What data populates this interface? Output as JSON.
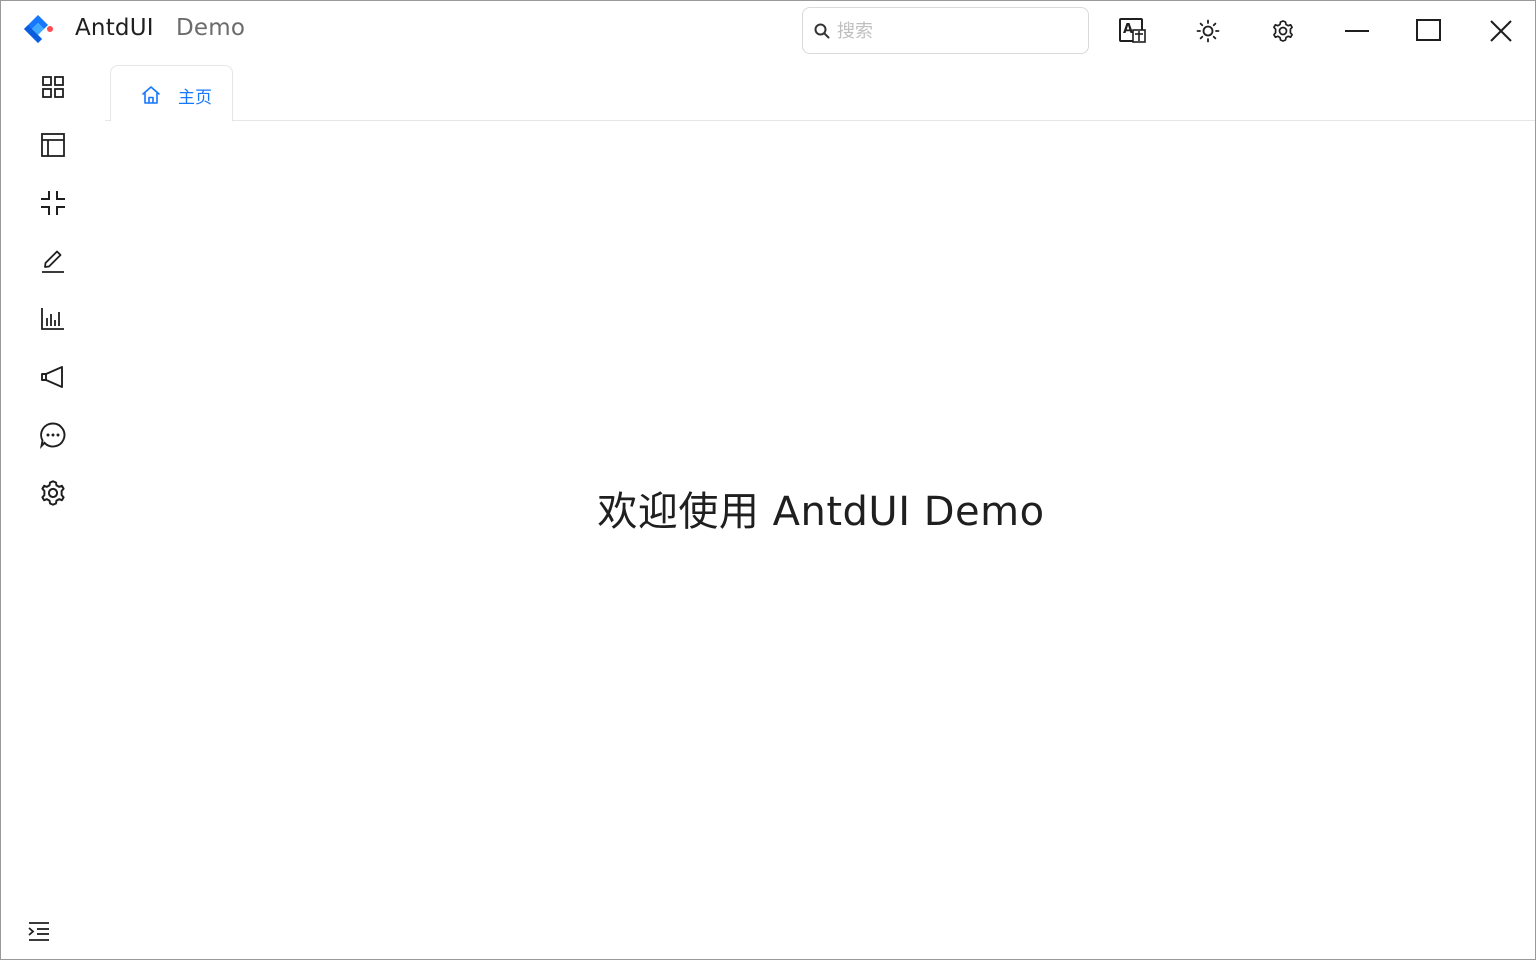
{
  "titlebar": {
    "app_name": "AntdUI",
    "app_subtitle": "Demo",
    "logo_icon": "antdui-logo-icon",
    "search": {
      "placeholder": "搜索",
      "value": ""
    },
    "buttons": [
      {
        "name": "translate-icon"
      },
      {
        "name": "sun-icon"
      },
      {
        "name": "settings-icon"
      },
      {
        "name": "minimize-icon"
      },
      {
        "name": "maximize-icon"
      },
      {
        "name": "close-icon"
      }
    ]
  },
  "sidebar": {
    "items": [
      {
        "icon": "appstore-icon"
      },
      {
        "icon": "layout-icon"
      },
      {
        "icon": "compress-icon"
      },
      {
        "icon": "edit-icon"
      },
      {
        "icon": "bar-chart-icon"
      },
      {
        "icon": "notification-icon"
      },
      {
        "icon": "message-icon"
      },
      {
        "icon": "setting-icon"
      }
    ],
    "collapse_icon": "menu-unfold-icon"
  },
  "tabs": [
    {
      "label": "主页",
      "icon": "home-icon",
      "active": true
    }
  ],
  "main": {
    "welcome_text": "欢迎使用 AntdUI  Demo"
  },
  "colors": {
    "accent": "#1677ff",
    "text": "#1f1f1f",
    "muted": "#6b6b6b",
    "border": "#e6e6e6"
  }
}
